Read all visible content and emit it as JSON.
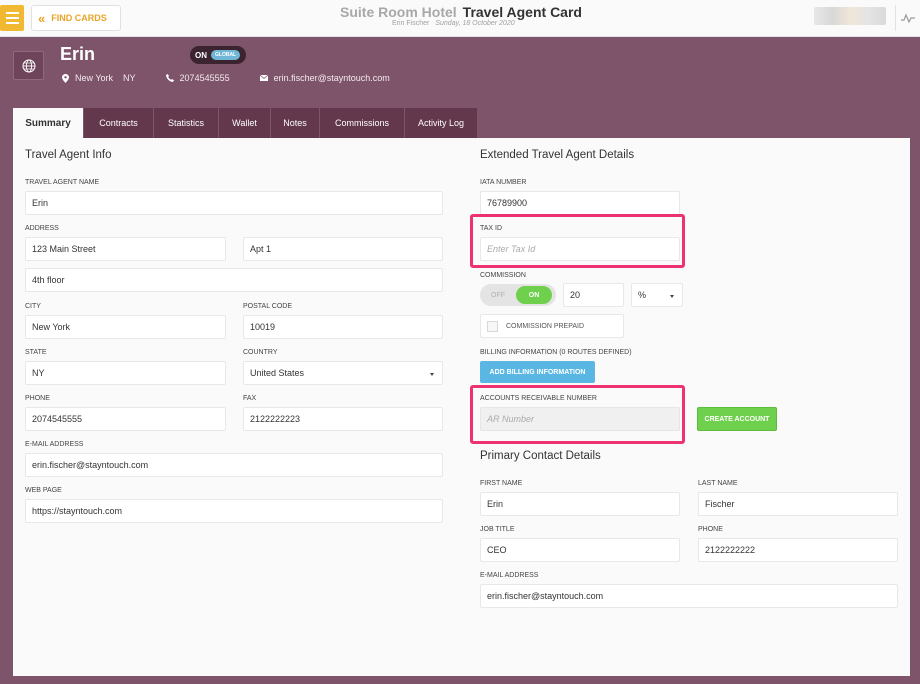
{
  "header": {
    "find_cards_label": "FIND CARDS",
    "hotel_name": "Suite Room Hotel",
    "page_title": "Travel Agent Card",
    "user_name": "Erin Fischer",
    "date": "Sunday, 18 October 2020"
  },
  "profile": {
    "name": "Erin",
    "toggle_on": "ON",
    "toggle_scope": "GLOBAL",
    "city": "New York",
    "state": "NY",
    "phone": "2074545555",
    "email": "erin.fischer@stayntouch.com"
  },
  "tabs": [
    {
      "label": "Summary"
    },
    {
      "label": "Contracts"
    },
    {
      "label": "Statistics"
    },
    {
      "label": "Wallet"
    },
    {
      "label": "Notes"
    },
    {
      "label": "Commissions"
    },
    {
      "label": "Activity Log"
    }
  ],
  "agent_info": {
    "title": "Travel Agent Info",
    "name_label": "TRAVEL AGENT NAME",
    "name_value": "Erin",
    "address_label": "ADDRESS",
    "address_line1": "123 Main Street",
    "address_line2": "Apt 1",
    "address_line3": "4th floor",
    "city_label": "CITY",
    "city_value": "New York",
    "postal_label": "POSTAL CODE",
    "postal_value": "10019",
    "state_label": "STATE",
    "state_value": "NY",
    "country_label": "COUNTRY",
    "country_value": "United States",
    "phone_label": "PHONE",
    "phone_value": "2074545555",
    "fax_label": "FAX",
    "fax_value": "2122222223",
    "email_label": "E-MAIL ADDRESS",
    "email_value": "erin.fischer@stayntouch.com",
    "web_label": "WEB PAGE",
    "web_value": "https://stayntouch.com"
  },
  "extended": {
    "title": "Extended Travel Agent Details",
    "iata_label": "IATA NUMBER",
    "iata_value": "76789900",
    "tax_label": "TAX ID",
    "tax_placeholder": "Enter Tax Id",
    "commission_label": "COMMISSION",
    "commission_off": "OFF",
    "commission_on": "ON",
    "commission_value": "20",
    "commission_unit": "%",
    "commission_prepaid": "COMMISSION PREPAID",
    "billing_label": "BILLING INFORMATION (0 ROUTES DEFINED)",
    "billing_button": "ADD BILLING INFORMATION",
    "ar_label": "ACCOUNTS RECEIVABLE NUMBER",
    "ar_placeholder": "AR Number",
    "create_account_button": "CREATE ACCOUNT"
  },
  "primary_contact": {
    "title": "Primary Contact Details",
    "first_label": "FIRST NAME",
    "first_value": "Erin",
    "last_label": "LAST NAME",
    "last_value": "Fischer",
    "job_label": "JOB TITLE",
    "job_value": "CEO",
    "phone_label": "PHONE",
    "phone_value": "2122222222",
    "email_label": "E-MAIL ADDRESS",
    "email_value": "erin.fischer@stayntouch.com"
  },
  "colors": {
    "accent_yellow": "#f1b931",
    "profile_bg": "#7d5469",
    "tab_bg": "#63384d",
    "highlight": "#ed336f",
    "button_blue": "#5ab7e4",
    "button_green": "#6ed04c"
  }
}
